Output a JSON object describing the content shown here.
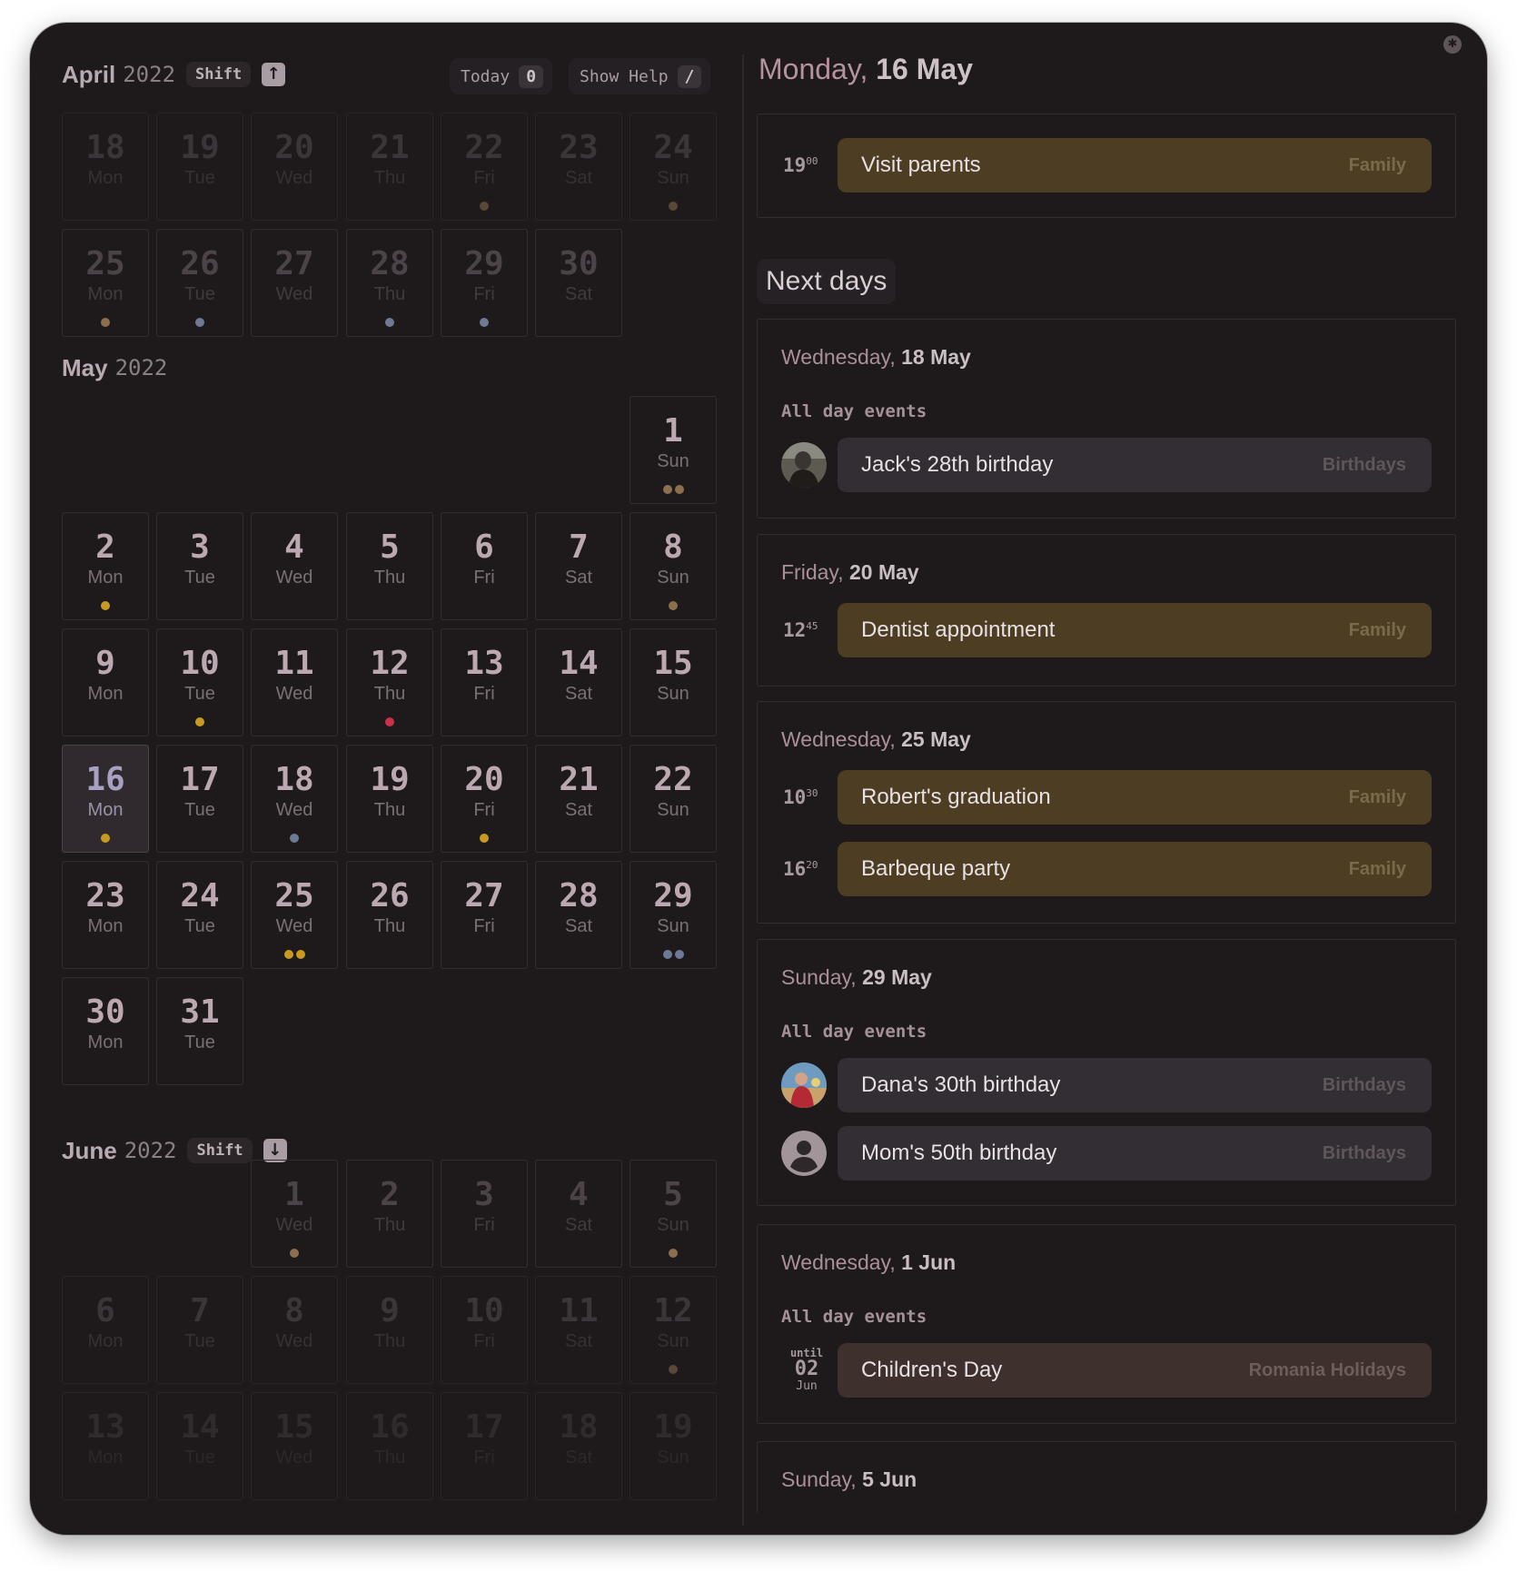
{
  "colors": {
    "family": "#4d3e23",
    "birthdays": "#332e33",
    "holidays": "#3d302d",
    "dot_yellow": "#c89a1f",
    "dot_brown": "#8b6f4e",
    "dot_blue": "#6e7a95",
    "dot_red": "#c9304a"
  },
  "toolbar": {
    "shift_label": "Shift",
    "today_label": "Today",
    "today_key": "0",
    "help_label": "Show Help",
    "help_key": "/"
  },
  "months": [
    {
      "name": "April",
      "year": "2022",
      "days": [
        {
          "n": "18",
          "d": "Mon",
          "dots": []
        },
        {
          "n": "19",
          "d": "Tue",
          "dots": []
        },
        {
          "n": "20",
          "d": "Wed",
          "dots": []
        },
        {
          "n": "21",
          "d": "Thu",
          "dots": []
        },
        {
          "n": "22",
          "d": "Fri",
          "dots": [
            "brown"
          ]
        },
        {
          "n": "23",
          "d": "Sat",
          "dots": []
        },
        {
          "n": "24",
          "d": "Sun",
          "dots": [
            "brown"
          ]
        },
        {
          "n": "25",
          "d": "Mon",
          "dots": [
            "brown"
          ]
        },
        {
          "n": "26",
          "d": "Tue",
          "dots": [
            "blue"
          ]
        },
        {
          "n": "27",
          "d": "Wed",
          "dots": []
        },
        {
          "n": "28",
          "d": "Thu",
          "dots": [
            "blue"
          ]
        },
        {
          "n": "29",
          "d": "Fri",
          "dots": [
            "blue"
          ]
        },
        {
          "n": "30",
          "d": "Sat",
          "dots": []
        }
      ]
    },
    {
      "name": "May",
      "year": "2022",
      "days": [
        {
          "n": "1",
          "d": "Sun",
          "dots": [
            "brown",
            "brown"
          ]
        },
        {
          "n": "2",
          "d": "Mon",
          "dots": [
            "yellow"
          ]
        },
        {
          "n": "3",
          "d": "Tue",
          "dots": []
        },
        {
          "n": "4",
          "d": "Wed",
          "dots": []
        },
        {
          "n": "5",
          "d": "Thu",
          "dots": []
        },
        {
          "n": "6",
          "d": "Fri",
          "dots": []
        },
        {
          "n": "7",
          "d": "Sat",
          "dots": []
        },
        {
          "n": "8",
          "d": "Sun",
          "dots": [
            "brown"
          ]
        },
        {
          "n": "9",
          "d": "Mon",
          "dots": []
        },
        {
          "n": "10",
          "d": "Tue",
          "dots": [
            "yellow"
          ]
        },
        {
          "n": "11",
          "d": "Wed",
          "dots": []
        },
        {
          "n": "12",
          "d": "Thu",
          "dots": [
            "red"
          ]
        },
        {
          "n": "13",
          "d": "Fri",
          "dots": []
        },
        {
          "n": "14",
          "d": "Sat",
          "dots": []
        },
        {
          "n": "15",
          "d": "Sun",
          "dots": []
        },
        {
          "n": "16",
          "d": "Mon",
          "dots": [
            "yellow"
          ]
        },
        {
          "n": "17",
          "d": "Tue",
          "dots": []
        },
        {
          "n": "18",
          "d": "Wed",
          "dots": [
            "blue"
          ]
        },
        {
          "n": "19",
          "d": "Thu",
          "dots": []
        },
        {
          "n": "20",
          "d": "Fri",
          "dots": [
            "yellow"
          ]
        },
        {
          "n": "21",
          "d": "Sat",
          "dots": []
        },
        {
          "n": "22",
          "d": "Sun",
          "dots": []
        },
        {
          "n": "23",
          "d": "Mon",
          "dots": []
        },
        {
          "n": "24",
          "d": "Tue",
          "dots": []
        },
        {
          "n": "25",
          "d": "Wed",
          "dots": [
            "yellow",
            "yellow"
          ]
        },
        {
          "n": "26",
          "d": "Thu",
          "dots": []
        },
        {
          "n": "27",
          "d": "Fri",
          "dots": []
        },
        {
          "n": "28",
          "d": "Sat",
          "dots": []
        },
        {
          "n": "29",
          "d": "Sun",
          "dots": [
            "blue",
            "blue"
          ]
        },
        {
          "n": "30",
          "d": "Mon",
          "dots": []
        },
        {
          "n": "31",
          "d": "Tue",
          "dots": []
        }
      ]
    },
    {
      "name": "June",
      "year": "2022",
      "days": [
        {
          "n": "1",
          "d": "Wed",
          "dots": [
            "brown"
          ]
        },
        {
          "n": "2",
          "d": "Thu",
          "dots": []
        },
        {
          "n": "3",
          "d": "Fri",
          "dots": []
        },
        {
          "n": "4",
          "d": "Sat",
          "dots": []
        },
        {
          "n": "5",
          "d": "Sun",
          "dots": [
            "brown"
          ]
        },
        {
          "n": "6",
          "d": "Mon",
          "dots": []
        },
        {
          "n": "7",
          "d": "Tue",
          "dots": []
        },
        {
          "n": "8",
          "d": "Wed",
          "dots": []
        },
        {
          "n": "9",
          "d": "Thu",
          "dots": []
        },
        {
          "n": "10",
          "d": "Fri",
          "dots": []
        },
        {
          "n": "11",
          "d": "Sat",
          "dots": []
        },
        {
          "n": "12",
          "d": "Sun",
          "dots": [
            "brown"
          ]
        },
        {
          "n": "13",
          "d": "Mon",
          "dots": []
        },
        {
          "n": "14",
          "d": "Tue",
          "dots": []
        },
        {
          "n": "15",
          "d": "Wed",
          "dots": []
        },
        {
          "n": "16",
          "d": "Thu",
          "dots": []
        },
        {
          "n": "17",
          "d": "Fri",
          "dots": []
        },
        {
          "n": "18",
          "d": "Sat",
          "dots": []
        },
        {
          "n": "19",
          "d": "Sun",
          "dots": []
        }
      ]
    }
  ],
  "agenda": {
    "current": {
      "weekday": "Monday,",
      "date": "16 May",
      "events": [
        {
          "hour": "19",
          "min": "00",
          "title": "Visit parents",
          "calendar": "Family"
        }
      ]
    },
    "next_days_label": "Next days",
    "all_day_label": "All day events",
    "days": [
      {
        "weekday": "Wednesday,",
        "date": "18 May",
        "allday": [
          {
            "title": "Jack's 28th birthday",
            "calendar": "Birthdays",
            "avatar": "photo-man"
          }
        ],
        "timed": []
      },
      {
        "weekday": "Friday,",
        "date": "20 May",
        "allday": [],
        "timed": [
          {
            "hour": "12",
            "min": "45",
            "title": "Dentist appointment",
            "calendar": "Family"
          }
        ]
      },
      {
        "weekday": "Wednesday,",
        "date": "25 May",
        "allday": [],
        "timed": [
          {
            "hour": "10",
            "min": "30",
            "title": "Robert's graduation",
            "calendar": "Family"
          },
          {
            "hour": "16",
            "min": "20",
            "title": "Barbeque party",
            "calendar": "Family"
          }
        ]
      },
      {
        "weekday": "Sunday,",
        "date": "29 May",
        "allday": [
          {
            "title": "Dana's 30th birthday",
            "calendar": "Birthdays",
            "avatar": "photo-woman"
          },
          {
            "title": "Mom's 50th birthday",
            "calendar": "Birthdays",
            "avatar": "default-avatar"
          }
        ],
        "timed": []
      },
      {
        "weekday": "Wednesday,",
        "date": "1 Jun",
        "allday": [
          {
            "title": "Children's Day",
            "calendar": "Romania Holidays",
            "until_label": "until",
            "until_day": "02",
            "until_month": "Jun"
          }
        ],
        "timed": []
      },
      {
        "weekday": "Sunday,",
        "date": "5 Jun",
        "allday": [],
        "timed": []
      }
    ]
  }
}
